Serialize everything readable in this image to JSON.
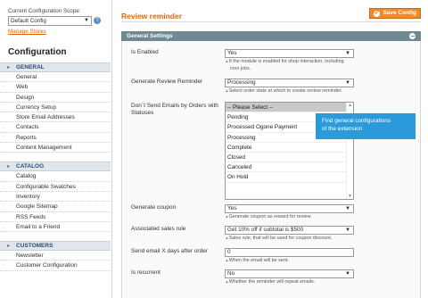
{
  "sidebar": {
    "scope_label": "Current Configuration Scope:",
    "scope_value": "Default Config",
    "manage_stores": "Manage Stores",
    "title": "Configuration",
    "sections": [
      {
        "label": "GENERAL",
        "items": [
          "General",
          "Web",
          "Design",
          "Currency Setup",
          "Store Email Addresses",
          "Contacts",
          "Reports",
          "Content Management"
        ]
      },
      {
        "label": "CATALOG",
        "items": [
          "Catalog",
          "Configurable Swatches",
          "Inventory",
          "Google Sitemap",
          "RSS Feeds",
          "Email to a Friend"
        ]
      },
      {
        "label": "CUSTOMERS",
        "items": [
          "Newsletter",
          "Customer Configuration"
        ]
      }
    ]
  },
  "main": {
    "title": "Review reminder",
    "save_label": "Save Config",
    "fieldset_title": "General Settings",
    "fields": {
      "enabled": {
        "label": "Is Enabled",
        "value": "Yes",
        "note": "If the module is enabled for shop interaction, including",
        "note2": "cron jobs."
      },
      "generate_reminder": {
        "label": "Generate Review Reminder",
        "value": "Processing",
        "note": "Select order state at which to create review reminder."
      },
      "dont_send": {
        "label": "Don`t Send Emails by Orders with",
        "label2": "Statuses",
        "options": [
          "-- Please Select --",
          "Pending",
          "Processed Ogone Payment",
          "Processing",
          "Complete",
          "Closed",
          "Canceled",
          "On Hold"
        ]
      },
      "coupon": {
        "label": "Generate coupon",
        "value": "Yes",
        "note": "Generate coupon as reward for review."
      },
      "sales_rule": {
        "label": "Associated sales rule",
        "value": "Get 10% off if subtotal is $500",
        "note": "Sales rule, that will be used for coupon discount."
      },
      "days_after": {
        "label": "Send email X days after order",
        "value": "0",
        "note": "When the email will be sent."
      },
      "recurrent": {
        "label": "Is recurrent",
        "value": "No",
        "note": "Whether the reminder will repeat emails."
      }
    },
    "tooltip": {
      "line1": "Find general configurations",
      "line2": "of the extension"
    }
  },
  "colors": {
    "accent": "#e26703",
    "fieldset_header": "#6f8992",
    "tooltip": "#2b9adb",
    "save_button": "#f08a2e"
  },
  "icons": {
    "help": "help-icon",
    "save": "check-icon",
    "collapse": "collapse-icon",
    "dropdown": "chevron-down-icon"
  }
}
